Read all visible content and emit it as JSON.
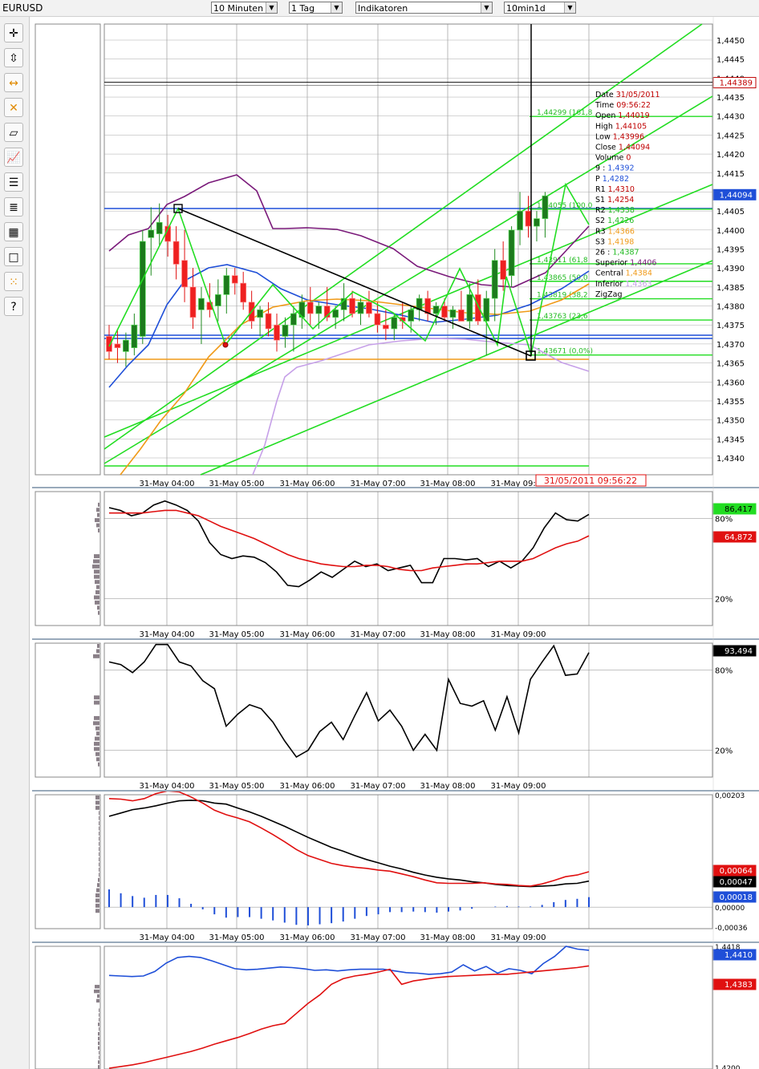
{
  "header": {
    "symbol": "EURUSD",
    "dropdowns": [
      {
        "value": "10 Minuten"
      },
      {
        "value": "1 Tag"
      },
      {
        "value": "Indikatoren"
      },
      {
        "value": "10min1d"
      }
    ]
  },
  "toolbar": {
    "tools": [
      "crosshair-icon",
      "price-tool-icon",
      "horizontal-line-icon",
      "delete-icon",
      "eraser-icon",
      "chart-type-icon",
      "list-icon",
      "settings-list-icon",
      "grid-tool-icon",
      "rectangle-icon",
      "dots-icon",
      "help-icon"
    ],
    "help_glyph": "?"
  },
  "colors": {
    "up_candle": "#1f8a1f",
    "down_candle": "#e01010",
    "green_lines": "#22dd22",
    "purple": "#7a1a7a",
    "blue": "#1f4fd8",
    "orange": "#f09a18",
    "lavender": "#c6a0e8",
    "red": "#e01010",
    "black": "#000000"
  },
  "chart_data": [
    {
      "type": "candlestick",
      "symbol": "EURUSD",
      "x_tick_labels": [
        "31-May 04:00",
        "31-May 05:00",
        "31-May 06:00",
        "31-May 07:00",
        "31-May 08:00",
        "31-May 09:00"
      ],
      "y_tick_labels": [
        "1,4450",
        "1,4445",
        "1,4440",
        "1,4435",
        "1,4430",
        "1,4425",
        "1,4420",
        "1,4415",
        "1,4410",
        "1,4405",
        "1,4400",
        "1,4395",
        "1,4390",
        "1,4385",
        "1,4380",
        "1,4375",
        "1,4370",
        "1,4365",
        "1,4360",
        "1,4355",
        "1,4350",
        "1,4345",
        "1,4340"
      ],
      "ylim": [
        1.4337,
        1.4452
      ],
      "candles": [
        {
          "o": 1.4372,
          "h": 1.4375,
          "l": 1.4366,
          "c": 1.4368
        },
        {
          "o": 1.437,
          "h": 1.4374,
          "l": 1.4365,
          "c": 1.4369
        },
        {
          "o": 1.4368,
          "h": 1.4373,
          "l": 1.4364,
          "c": 1.4371
        },
        {
          "o": 1.4369,
          "h": 1.4378,
          "l": 1.4367,
          "c": 1.4375
        },
        {
          "o": 1.4372,
          "h": 1.44,
          "l": 1.437,
          "c": 1.4397
        },
        {
          "o": 1.4398,
          "h": 1.4406,
          "l": 1.4388,
          "c": 1.44
        },
        {
          "o": 1.4399,
          "h": 1.4407,
          "l": 1.4396,
          "c": 1.4402
        },
        {
          "o": 1.4401,
          "h": 1.4404,
          "l": 1.4393,
          "c": 1.4397
        },
        {
          "o": 1.4397,
          "h": 1.4401,
          "l": 1.4387,
          "c": 1.4391
        },
        {
          "o": 1.4392,
          "h": 1.44,
          "l": 1.4381,
          "c": 1.4385
        },
        {
          "o": 1.4385,
          "h": 1.439,
          "l": 1.4374,
          "c": 1.4377
        },
        {
          "o": 1.4379,
          "h": 1.4385,
          "l": 1.437,
          "c": 1.4382
        },
        {
          "o": 1.4381,
          "h": 1.4386,
          "l": 1.4377,
          "c": 1.4379
        },
        {
          "o": 1.438,
          "h": 1.4387,
          "l": 1.4376,
          "c": 1.4383
        },
        {
          "o": 1.4383,
          "h": 1.439,
          "l": 1.4378,
          "c": 1.4388
        },
        {
          "o": 1.4388,
          "h": 1.439,
          "l": 1.4383,
          "c": 1.4386
        },
        {
          "o": 1.4386,
          "h": 1.4389,
          "l": 1.4379,
          "c": 1.4381
        },
        {
          "o": 1.4381,
          "h": 1.4384,
          "l": 1.4374,
          "c": 1.4376
        },
        {
          "o": 1.4377,
          "h": 1.438,
          "l": 1.4372,
          "c": 1.4379
        },
        {
          "o": 1.4378,
          "h": 1.4381,
          "l": 1.4372,
          "c": 1.4374
        },
        {
          "o": 1.4375,
          "h": 1.4378,
          "l": 1.4368,
          "c": 1.4371
        },
        {
          "o": 1.4372,
          "h": 1.4377,
          "l": 1.4369,
          "c": 1.4375
        },
        {
          "o": 1.4375,
          "h": 1.438,
          "l": 1.4368,
          "c": 1.4378
        },
        {
          "o": 1.4377,
          "h": 1.4383,
          "l": 1.4374,
          "c": 1.4381
        },
        {
          "o": 1.4381,
          "h": 1.4385,
          "l": 1.4375,
          "c": 1.4378
        },
        {
          "o": 1.4378,
          "h": 1.4381,
          "l": 1.4374,
          "c": 1.438
        },
        {
          "o": 1.438,
          "h": 1.4385,
          "l": 1.4376,
          "c": 1.4377
        },
        {
          "o": 1.4377,
          "h": 1.438,
          "l": 1.4374,
          "c": 1.4379
        },
        {
          "o": 1.4379,
          "h": 1.4386,
          "l": 1.4376,
          "c": 1.4382
        },
        {
          "o": 1.4382,
          "h": 1.4384,
          "l": 1.4377,
          "c": 1.4378
        },
        {
          "o": 1.4378,
          "h": 1.4382,
          "l": 1.4375,
          "c": 1.4381
        },
        {
          "o": 1.4381,
          "h": 1.4384,
          "l": 1.4377,
          "c": 1.4378
        },
        {
          "o": 1.4378,
          "h": 1.4381,
          "l": 1.4373,
          "c": 1.4375
        },
        {
          "o": 1.4375,
          "h": 1.4379,
          "l": 1.4371,
          "c": 1.4374
        },
        {
          "o": 1.4374,
          "h": 1.4378,
          "l": 1.4371,
          "c": 1.4377
        },
        {
          "o": 1.4377,
          "h": 1.4381,
          "l": 1.4374,
          "c": 1.4376
        },
        {
          "o": 1.4376,
          "h": 1.438,
          "l": 1.4373,
          "c": 1.4379
        },
        {
          "o": 1.4379,
          "h": 1.4383,
          "l": 1.4376,
          "c": 1.4382
        },
        {
          "o": 1.4382,
          "h": 1.4384,
          "l": 1.4376,
          "c": 1.4378
        },
        {
          "o": 1.4378,
          "h": 1.4381,
          "l": 1.4375,
          "c": 1.438
        },
        {
          "o": 1.438,
          "h": 1.4382,
          "l": 1.4376,
          "c": 1.4377
        },
        {
          "o": 1.4377,
          "h": 1.438,
          "l": 1.4374,
          "c": 1.4379
        },
        {
          "o": 1.4379,
          "h": 1.4384,
          "l": 1.4376,
          "c": 1.4376
        },
        {
          "o": 1.4376,
          "h": 1.4386,
          "l": 1.4374,
          "c": 1.4383
        },
        {
          "o": 1.4383,
          "h": 1.4387,
          "l": 1.4375,
          "c": 1.4376
        },
        {
          "o": 1.4376,
          "h": 1.4384,
          "l": 1.4367,
          "c": 1.4382
        },
        {
          "o": 1.4382,
          "h": 1.4395,
          "l": 1.4376,
          "c": 1.4392
        },
        {
          "o": 1.4392,
          "h": 1.4397,
          "l": 1.4384,
          "c": 1.4387
        },
        {
          "o": 1.4388,
          "h": 1.4401,
          "l": 1.4385,
          "c": 1.44
        },
        {
          "o": 1.44,
          "h": 1.441,
          "l": 1.4396,
          "c": 1.4405
        },
        {
          "o": 1.4405,
          "h": 1.4409,
          "l": 1.4398,
          "c": 1.4401
        },
        {
          "o": 1.4401,
          "h": 1.4405,
          "l": 1.4397,
          "c": 1.4403
        },
        {
          "o": 1.4403,
          "h": 1.441,
          "l": 1.4398,
          "c": 1.4409
        }
      ],
      "price_markers": [
        {
          "value": "1,44389",
          "color": "#c00000",
          "bg": "#ffffff"
        },
        {
          "value": "1,44094",
          "color": "#ffffff",
          "bg": "#1f4fd8"
        }
      ],
      "fib_labels": [
        "1,44299 (161,8",
        "1,44055 (100,0",
        "1,43911 (61,8",
        "1,43865 (50,0",
        "1,43819 (38,2",
        "1,43763 (23,6",
        "1,43671 (0,0%)"
      ],
      "fib_levels": [
        1.44299,
        1.44055,
        1.43911,
        1.43865,
        1.43819,
        1.43763,
        1.43671
      ],
      "cursor_time_label": "31/05/2011 09:56:22",
      "info_box": [
        {
          "label": "Date",
          "value": "31/05/2011",
          "color": "#c00000"
        },
        {
          "label": "Time",
          "value": "09:56:22",
          "color": "#c00000"
        },
        {
          "label": "Open",
          "value": "1,44019",
          "color": "#c00000"
        },
        {
          "label": "High",
          "value": "1,44105",
          "color": "#c00000"
        },
        {
          "label": "Low",
          "value": "1,43996",
          "color": "#c00000"
        },
        {
          "label": "Close",
          "value": "1,44094",
          "color": "#c00000"
        },
        {
          "label": "Volume",
          "value": "0",
          "color": "#c00000"
        },
        {
          "label": "9 :",
          "value": "1,4392",
          "color": "#1f4fd8"
        },
        {
          "label": "P",
          "value": "1,4282",
          "color": "#1f4fd8"
        },
        {
          "label": "R1",
          "value": "1,4310",
          "color": "#c00000"
        },
        {
          "label": "S1",
          "value": "1,4254",
          "color": "#c00000"
        },
        {
          "label": "R2",
          "value": "1,4338",
          "color": "#22bb22"
        },
        {
          "label": "S2",
          "value": "1,4226",
          "color": "#22bb22"
        },
        {
          "label": "R3",
          "value": "1,4366",
          "color": "#f09a18"
        },
        {
          "label": "S3",
          "value": "1,4198",
          "color": "#f09a18"
        },
        {
          "label": "26 :",
          "value": "1,4387",
          "color": "#22bb22"
        },
        {
          "label": "Superior",
          "value": "1,4406",
          "color": "#7a1a7a"
        },
        {
          "label": "Central",
          "value": "1,4384",
          "color": "#f09a18"
        },
        {
          "label": "Inferior",
          "value": "1,4363",
          "color": "#c6a0e8"
        },
        {
          "label": "ZigZag",
          "value": "",
          "color": "#000000"
        }
      ]
    },
    {
      "type": "line",
      "x_tick_labels": [
        "31-May 04:00",
        "31-May 05:00",
        "31-May 06:00",
        "31-May 07:00",
        "31-May 08:00",
        "31-May 09:00"
      ],
      "y_tick_labels": [
        "80%",
        "20%"
      ],
      "ylim": [
        0,
        100
      ],
      "series": [
        {
          "color": "#000000",
          "values": [
            88,
            86,
            82,
            84,
            90,
            93,
            90,
            86,
            78,
            62,
            53,
            50,
            52,
            51,
            47,
            40,
            30,
            29,
            34,
            40,
            36,
            42,
            48,
            44,
            46,
            41,
            43,
            45,
            32,
            32,
            50,
            50,
            49,
            50,
            44,
            48,
            43,
            48,
            58,
            73,
            84,
            79,
            78,
            83
          ]
        },
        {
          "color": "#e01010",
          "values": [
            84,
            84,
            84,
            84,
            85,
            86,
            86,
            84,
            82,
            78,
            74,
            71,
            68,
            65,
            61,
            57,
            53,
            50,
            48,
            46,
            45,
            44,
            44,
            45,
            45,
            44,
            42,
            41,
            41,
            43,
            44,
            45,
            46,
            46,
            47,
            48,
            48,
            48,
            50,
            54,
            58,
            61,
            63,
            67
          ]
        }
      ],
      "price_markers": [
        {
          "value": "86,417",
          "color": "#000000",
          "bg": "#22dd22"
        },
        {
          "value": "64,872",
          "color": "#ffffff",
          "bg": "#e01010"
        }
      ]
    },
    {
      "type": "line",
      "x_tick_labels": [
        "31-May 04:00",
        "31-May 05:00",
        "31-May 06:00",
        "31-May 07:00",
        "31-May 08:00",
        "31-May 09:00"
      ],
      "y_tick_labels": [
        "80%",
        "20%"
      ],
      "ylim": [
        0,
        100
      ],
      "series": [
        {
          "color": "#000000",
          "values": [
            86,
            84,
            78,
            86,
            99,
            99,
            86,
            83,
            72,
            66,
            38,
            47,
            54,
            51,
            41,
            27,
            15,
            20,
            34,
            41,
            28,
            46,
            63,
            42,
            50,
            38,
            20,
            32,
            20,
            73,
            55,
            53,
            57,
            35,
            60,
            33,
            73,
            86,
            98,
            76,
            77,
            93
          ]
        }
      ],
      "price_markers": [
        {
          "value": "93,494",
          "color": "#ffffff",
          "bg": "#000000"
        }
      ]
    },
    {
      "type": "line",
      "x_tick_labels": [
        "31-May 04:00",
        "31-May 05:00",
        "31-May 06:00",
        "31-May 07:00",
        "31-May 08:00",
        "31-May 09:00"
      ],
      "y_tick_labels": [
        "0,00203",
        "0,00000",
        "-0,00036"
      ],
      "ylim": [
        -0.00036,
        0.00203
      ],
      "series": [
        {
          "color": "#000000",
          "values": [
            0.00164,
            0.0017,
            0.00176,
            0.00179,
            0.00183,
            0.00188,
            0.00192,
            0.00193,
            0.00192,
            0.00188,
            0.00186,
            0.00179,
            0.00172,
            0.00164,
            0.00155,
            0.00146,
            0.00136,
            0.00126,
            0.00117,
            0.00108,
            0.00101,
            0.00093,
            0.00086,
            0.0008,
            0.00074,
            0.00069,
            0.00063,
            0.00058,
            0.00054,
            0.00051,
            0.00049,
            0.00046,
            0.00044,
            0.00041,
            0.00039,
            0.00038,
            0.00037,
            0.00038,
            0.00039,
            0.00042,
            0.00043,
            0.00047
          ]
        },
        {
          "color": "#e01010",
          "values": [
            0.00196,
            0.00195,
            0.00192,
            0.00196,
            0.00205,
            0.0021,
            0.00208,
            0.00199,
            0.00188,
            0.00175,
            0.00167,
            0.00161,
            0.00154,
            0.00143,
            0.00131,
            0.00118,
            0.00104,
            0.00093,
            0.00086,
            0.00079,
            0.00075,
            0.00072,
            0.0007,
            0.00067,
            0.00065,
            0.0006,
            0.00055,
            0.00049,
            0.00044,
            0.00043,
            0.00043,
            0.00043,
            0.00044,
            0.00042,
            0.00041,
            0.00039,
            0.00038,
            0.00042,
            0.00048,
            0.00055,
            0.00058,
            0.00064
          ]
        }
      ],
      "histogram_values": [
        0.00032,
        0.00025,
        0.0002,
        0.00017,
        0.00022,
        0.00022,
        0.00016,
        6e-05,
        -4e-05,
        -0.00013,
        -0.00019,
        -0.00018,
        -0.00018,
        -0.00021,
        -0.00024,
        -0.00028,
        -0.00032,
        -0.00033,
        -0.00031,
        -0.00029,
        -0.00026,
        -0.00021,
        -0.00016,
        -0.00013,
        -9e-05,
        -9e-05,
        -8e-05,
        -9e-05,
        -0.0001,
        -8e-05,
        -6e-05,
        -3e-05,
        0.0,
        1e-05,
        2e-05,
        1e-05,
        1e-05,
        4e-05,
        9e-05,
        0.00013,
        0.00015,
        0.00018
      ],
      "price_markers": [
        {
          "value": "0,00064",
          "color": "#ffffff",
          "bg": "#e01010"
        },
        {
          "value": "0,00047",
          "color": "#ffffff",
          "bg": "#000000"
        },
        {
          "value": "0,00018",
          "color": "#ffffff",
          "bg": "#1f4fd8"
        }
      ]
    },
    {
      "type": "line",
      "y_tick_labels": [
        "1,4418",
        "1,4200"
      ],
      "ylim": [
        1.42,
        1.4418
      ],
      "series": [
        {
          "color": "#1f4fd8",
          "values": [
            1.4366,
            1.4365,
            1.4364,
            1.4365,
            1.4373,
            1.4388,
            1.4398,
            1.44,
            1.4398,
            1.4392,
            1.4385,
            1.4378,
            1.4376,
            1.4377,
            1.4379,
            1.4381,
            1.438,
            1.4378,
            1.4375,
            1.4376,
            1.4374,
            1.4376,
            1.4377,
            1.4377,
            1.4377,
            1.4374,
            1.4371,
            1.437,
            1.4368,
            1.4369,
            1.4372,
            1.4385,
            1.4374,
            1.4382,
            1.437,
            1.4378,
            1.4375,
            1.4369,
            1.4387,
            1.44,
            1.4418,
            1.4413,
            1.4411
          ]
        },
        {
          "color": "#e01010",
          "values": [
            1.42,
            1.4203,
            1.4206,
            1.421,
            1.4215,
            1.422,
            1.4225,
            1.423,
            1.4236,
            1.4243,
            1.4249,
            1.4255,
            1.4262,
            1.427,
            1.4276,
            1.428,
            1.4298,
            1.4316,
            1.4331,
            1.435,
            1.436,
            1.4365,
            1.4368,
            1.4372,
            1.4377,
            1.435,
            1.4356,
            1.4359,
            1.4362,
            1.4364,
            1.4365,
            1.4366,
            1.4367,
            1.4368,
            1.4368,
            1.437,
            1.4372,
            1.4374,
            1.4376,
            1.4378,
            1.438,
            1.4383
          ]
        }
      ],
      "price_markers": [
        {
          "value": "1,4410",
          "color": "#ffffff",
          "bg": "#1f4fd8"
        },
        {
          "value": "1,4383",
          "color": "#ffffff",
          "bg": "#e01010"
        }
      ]
    }
  ]
}
